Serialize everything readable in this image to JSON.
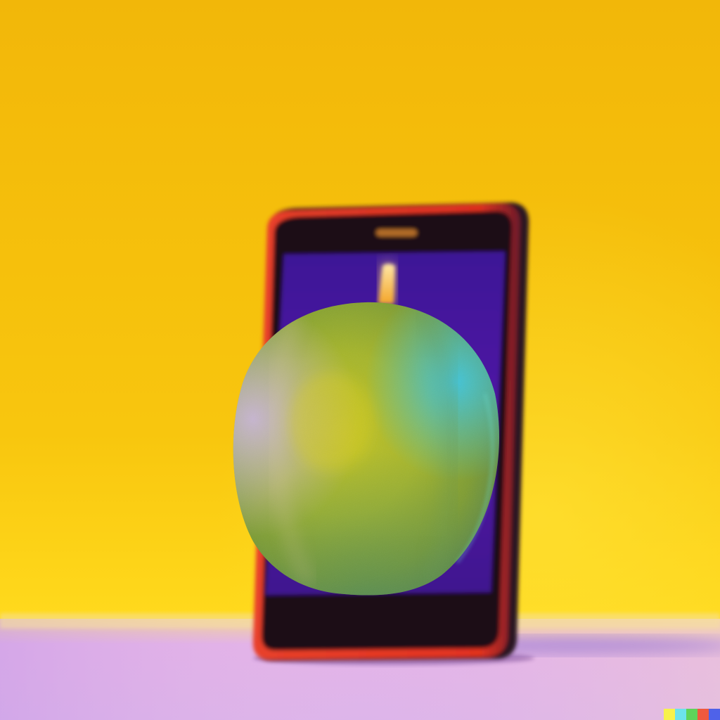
{
  "scene": {
    "description_colors": {
      "background_top": "#f3b90a",
      "background_bottom": "#fcd21a",
      "floor_lilac": "#d8b2e8",
      "floor_pink": "#e7b0e6",
      "phone_frame_red": "#e4321e",
      "phone_body_dark": "#1d0e16",
      "screen_purple": "#4a169e",
      "apple_green": "#9fb62d",
      "apple_highlight_cyan": "#3ec1d8",
      "apple_left_lilac": "#b7a8c8",
      "stem_glow": "#ffd880"
    },
    "icons": [
      "phone-speaker-icon",
      "apple-stem-icon"
    ]
  },
  "watermark": {
    "colors": [
      "#f7f24b",
      "#6ce3ec",
      "#5fd35a",
      "#f0593e",
      "#4f62e9"
    ]
  }
}
